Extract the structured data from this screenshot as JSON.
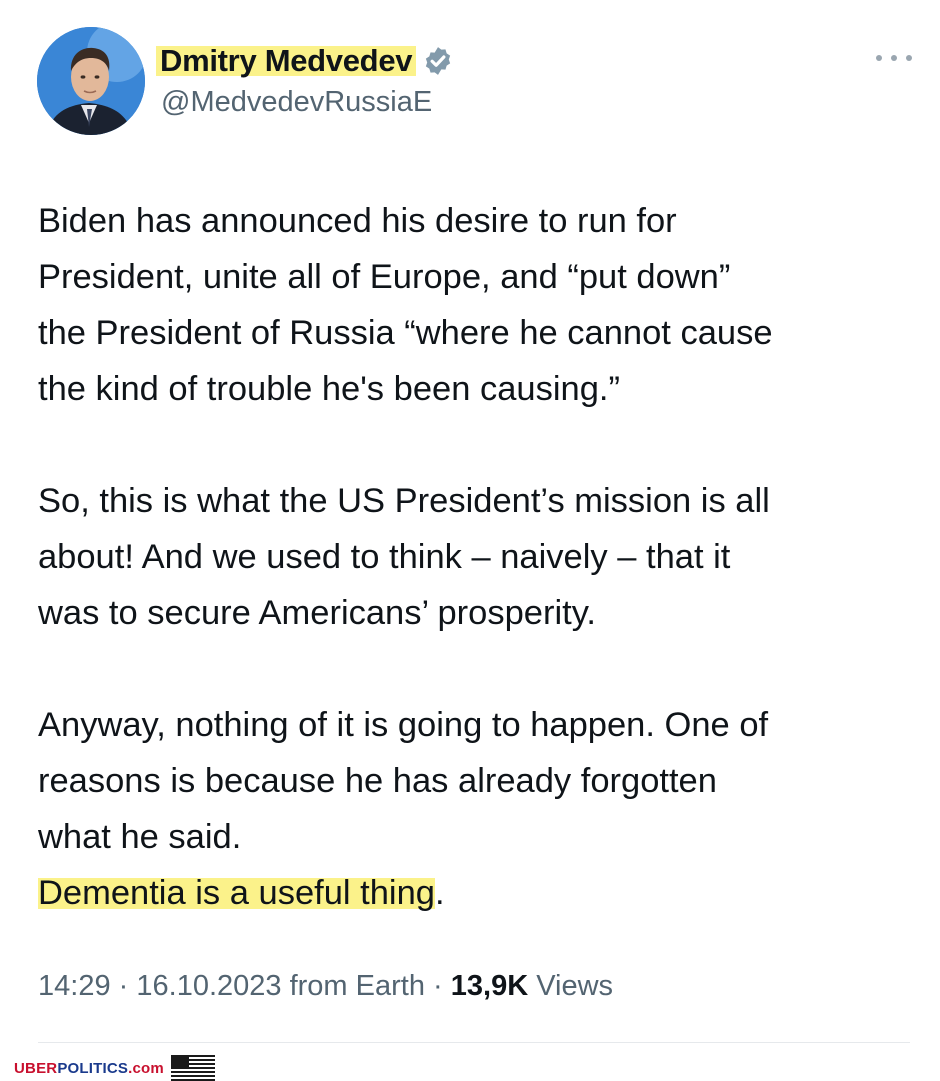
{
  "tweet": {
    "author": {
      "display_name": "Dmitry Medvedev",
      "handle": "@MedvedevRussiaE"
    },
    "icons": {
      "avatar": "avatar-photo",
      "verified": "verified-badge-icon",
      "more": "more-options-icon"
    },
    "paragraphs": [
      {
        "lines": [
          "Biden has announced his desire to run for",
          "President, unite all of Europe, and “put down”",
          "the President of Russia “where he cannot cause",
          "the kind of trouble he's been causing.”"
        ]
      },
      {
        "lines": [
          "So, this is what the US President’s mission is all",
          "about! And we used to think – naively – that it",
          "was to secure Americans’ prosperity."
        ]
      },
      {
        "lines": [
          "Anyway, nothing of it is going to happen. One of",
          "reasons is because he has already forgotten",
          "what he said."
        ],
        "highlighted_line": "Dementia is a useful thing",
        "highlighted_line_tail": "."
      }
    ],
    "meta": {
      "time": "14:29",
      "date": "16.10.2023",
      "source": "from Earth",
      "separator": "·",
      "views_count": "13,9K",
      "views_label": "Views"
    }
  },
  "watermark": {
    "part1": "UBER",
    "part2": "POLITICS",
    "part3": ".com",
    "icon": "us-flag-icon"
  },
  "colors": {
    "highlight": "#fbf28a",
    "verified_badge": "#829aab",
    "secondary_text": "#536471",
    "watermark_red": "#c8102e",
    "watermark_blue": "#1a3a8c"
  }
}
